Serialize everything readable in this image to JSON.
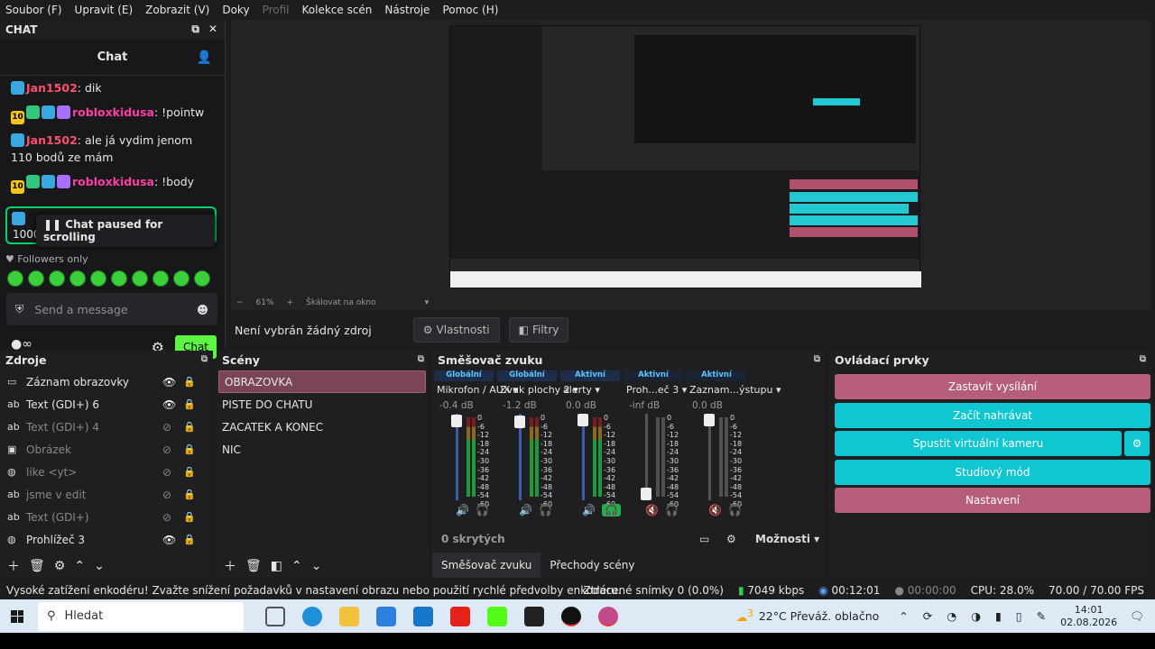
{
  "menu": [
    {
      "label": "Soubor (F)",
      "dim": false
    },
    {
      "label": "Upravit (E)",
      "dim": false
    },
    {
      "label": "Zobrazit (V)",
      "dim": false
    },
    {
      "label": "Doky",
      "dim": false
    },
    {
      "label": "Profil",
      "dim": true
    },
    {
      "label": "Kolekce scén",
      "dim": false
    },
    {
      "label": "Nástroje",
      "dim": false
    },
    {
      "label": "Pomoc (H)",
      "dim": false
    }
  ],
  "chat": {
    "dock_title": "CHAT",
    "header": "Chat",
    "messages": [
      {
        "user": "Jan1502",
        "text": ": dik",
        "color": "u1",
        "badges": [
          "blue"
        ]
      },
      {
        "user": "robloxkidusa",
        "text": ": !pointw",
        "color": "u2",
        "badges": [
          "sub",
          "grn",
          "blue",
          "purp"
        ],
        "sub": "10"
      },
      {
        "user": "Jan1502",
        "text": ": ale já vydim jenom 110 bodů ze mám",
        "color": "u1",
        "badges": [
          "blue"
        ]
      },
      {
        "user": "robloxkidusa",
        "text": ": !body",
        "color": "u2",
        "badges": [
          "sub",
          "grn",
          "blue",
          "purp"
        ],
        "sub": "10"
      }
    ],
    "paused_text": "Chat paused for scrolling",
    "paused_under": "1000",
    "followers": "Followers only",
    "send_placeholder": "Send a message",
    "chat_button": "Chat"
  },
  "preview": {
    "zoom": "61%",
    "scale_mode": "Škálovat na okno"
  },
  "source_bar": {
    "no_source": "Není vybrán žádný zdroj",
    "properties": "Vlastnosti",
    "filters": "Filtry"
  },
  "sources": {
    "title": "Zdroje",
    "items": [
      {
        "label": "Záznam obrazovky",
        "icon": "▭",
        "dim": false,
        "visible": true
      },
      {
        "label": "Text (GDI+) 6",
        "icon": "ab",
        "dim": false,
        "visible": true
      },
      {
        "label": "Text (GDI+) 4",
        "icon": "ab",
        "dim": true,
        "visible": false
      },
      {
        "label": "Obrázek",
        "icon": "▣",
        "dim": true,
        "visible": false
      },
      {
        "label": "like <yt>",
        "icon": "◍",
        "dim": true,
        "visible": false
      },
      {
        "label": "jsme v edit",
        "icon": "ab",
        "dim": true,
        "visible": false
      },
      {
        "label": "Text (GDI+)",
        "icon": "ab",
        "dim": true,
        "visible": false
      },
      {
        "label": "Prohlížeč 3",
        "icon": "◍",
        "dim": false,
        "visible": true
      }
    ]
  },
  "scenes": {
    "title": "Scény",
    "items": [
      "OBRAZOVKA",
      "PISTE DO CHATU",
      "ZACATEK A KONEC",
      "NIC"
    ]
  },
  "mixer": {
    "title": "Směšovač zvuku",
    "channels": [
      {
        "tag": "Globální",
        "name": "Mikrofon / AUX",
        "db": "-0.4 dB",
        "level": 0.99,
        "muted": false,
        "hp": false,
        "active": true
      },
      {
        "tag": "Globální",
        "name": "Zvuk plochy 2",
        "db": "-1.2 dB",
        "level": 0.97,
        "muted": false,
        "hp": false,
        "active": true
      },
      {
        "tag": "Aktivní",
        "name": "alerty",
        "db": "0.0 dB",
        "level": 1.0,
        "muted": false,
        "hp": true,
        "active": true
      },
      {
        "tag": "Aktivní",
        "name": "Proh...eč 3",
        "db": "-inf dB",
        "level": 0.0,
        "muted": true,
        "hp": false,
        "active": false
      },
      {
        "tag": "Aktivní",
        "name": "Zaznam...ýstupu",
        "db": "0.0 dB",
        "level": 1.0,
        "muted": true,
        "hp": false,
        "active": false
      }
    ],
    "ticks": [
      "0",
      "-6",
      "-12",
      "-18",
      "-24",
      "-30",
      "-36",
      "-42",
      "-48",
      "-54",
      "-60"
    ],
    "hidden": "0 skrytých",
    "options": "Možnosti",
    "tab_mixer": "Směšovač zvuku",
    "tab_transitions": "Přechody scény"
  },
  "controls": {
    "title": "Ovládací prvky",
    "stop_stream": "Zastavit vysílání",
    "start_rec": "Začít nahrávat",
    "virtual_cam": "Spustit virtuální kameru",
    "studio": "Studiový mód",
    "settings": "Nastavení"
  },
  "status": {
    "warning": "Vysoké zatížení enkodéru! Zvažte snížení požadavků v nastavení obrazu nebo použití rychlé předvolby enkodéru.",
    "dropped": "Ztracené snímky 0 (0.0%)",
    "kbps": "7049 kbps",
    "stream_time": "00:12:01",
    "rec_time": "00:00:00",
    "cpu": "CPU: 28.0%",
    "fps": "70.00 / 70.00 FPS"
  },
  "taskbar": {
    "search": "Hledat",
    "weather_badge": "3",
    "weather": "22°C Převáž. oblačno",
    "time": "14:01",
    "date": "02.08.2026"
  }
}
